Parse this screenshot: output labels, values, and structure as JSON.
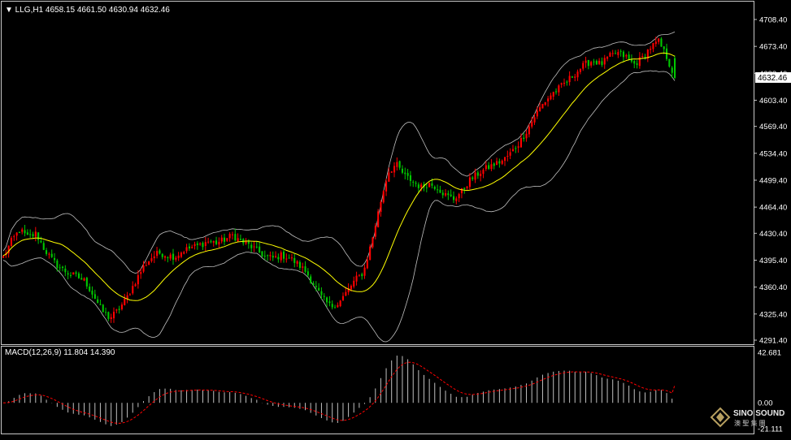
{
  "price_panel": {
    "header": "▼ LLG,H1  4658.15 4661.50 4630.94 4632.46",
    "current_price_label": "4632.46",
    "y_ticks": [
      "4708.40",
      "4673.40",
      "4638.40",
      "4603.40",
      "4569.40",
      "4534.40",
      "4499.40",
      "4464.40",
      "4430.40",
      "4395.40",
      "4360.40",
      "4325.40",
      "4291.40"
    ]
  },
  "macd_panel": {
    "header": "MACD(12,26,9) 11.804 14.390",
    "y_ticks": [
      "42.681",
      "0.00",
      "-21.111"
    ]
  },
  "watermark": {
    "brand": "SINO SOUND",
    "sub": "澳 聖 集 團"
  },
  "colors": {
    "background": "#000000",
    "frame": "#c8c8c8",
    "bull_candle": "#ff0000",
    "bear_candle": "#00c800",
    "moving_average": "#ffff00",
    "bollinger_bands": "#c0c0c0",
    "macd_histogram": "#c0c0c0",
    "macd_signal": "#ff0000"
  },
  "chart_data": [
    {
      "type": "candlestick",
      "symbol": "LLG",
      "timeframe": "H1",
      "last_bar": {
        "open": 4658.15,
        "high": 4661.5,
        "low": 4630.94,
        "close": 4632.46
      },
      "ylim": [
        4291.4,
        4708.4
      ],
      "indicators": [
        "moving average",
        "Bollinger Bands"
      ],
      "close_path": [
        4400,
        4420,
        4435,
        4425,
        4430,
        4410,
        4395,
        4385,
        4378,
        4374,
        4368,
        4350,
        4330,
        4320,
        4330,
        4345,
        4365,
        4385,
        4398,
        4405,
        4402,
        4400,
        4408,
        4412,
        4415,
        4420,
        4418,
        4422,
        4428,
        4420,
        4415,
        4408,
        4400,
        4398,
        4402,
        4398,
        4390,
        4380,
        4362,
        4345,
        4335,
        4340,
        4355,
        4370,
        4380,
        4420,
        4468,
        4510,
        4520,
        4505,
        4498,
        4490,
        4495,
        4490,
        4480,
        4475,
        4485,
        4500,
        4508,
        4515,
        4520,
        4525,
        4535,
        4548,
        4565,
        4585,
        4600,
        4612,
        4620,
        4630,
        4640,
        4650,
        4655,
        4650,
        4660,
        4665,
        4660,
        4650,
        4658,
        4672,
        4680,
        4660,
        4632.46
      ]
    },
    {
      "type": "bar",
      "name": "MACD(12,26,9)",
      "main_value": 11.804,
      "signal_value": 14.39,
      "ylim": [
        -21.111,
        42.681
      ],
      "grid": false
    }
  ]
}
